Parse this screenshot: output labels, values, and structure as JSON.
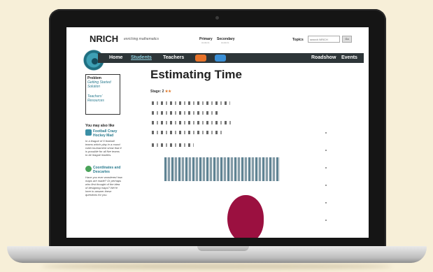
{
  "site": {
    "logo": "NRICH",
    "tagline": "enriching mathematics",
    "levels": [
      {
        "label": "Primary",
        "sub": "students"
      },
      {
        "label": "Secondary",
        "sub": "students"
      }
    ],
    "topics_label": "Topics",
    "search_placeholder": "search NRICH",
    "go_label": "Go"
  },
  "nav": {
    "items": [
      "Home",
      "Students",
      "Teachers"
    ],
    "right_items": [
      "Roadshow",
      "Events"
    ],
    "active": "Students",
    "pill_colors": [
      "#e8732a",
      "#3a8fd6"
    ]
  },
  "sidebar": {
    "problem_title": "Problem",
    "problem_links": [
      "Getting Started",
      "Solution"
    ],
    "teacher_links": [
      "Teachers'",
      "Resources"
    ],
    "also_like": "You may also like",
    "related": [
      {
        "title": [
          "Football Crazy",
          "Hockey Mad"
        ],
        "desc": [
          "In a league of 5 football",
          "teams which play in a round",
          "robin tournament show that it",
          "is possible for all five teams",
          "to be league leaders."
        ]
      },
      {
        "title": [
          "Coordinates and",
          "Descartes"
        ],
        "desc": [
          "Have you ever wondered how",
          "maps are made? Or perhaps",
          "who first thought of the idea",
          "of designing maps? We're",
          "here to answer these",
          "questions for you."
        ]
      }
    ]
  },
  "main": {
    "title": "Estimating Time",
    "stage": "Stage: 2",
    "stage_stars": "★★"
  },
  "colors": {
    "nav_bg": "#2d3538",
    "link": "#2a7b8f",
    "blob": "#9b1040",
    "background": "#f7efd8"
  }
}
